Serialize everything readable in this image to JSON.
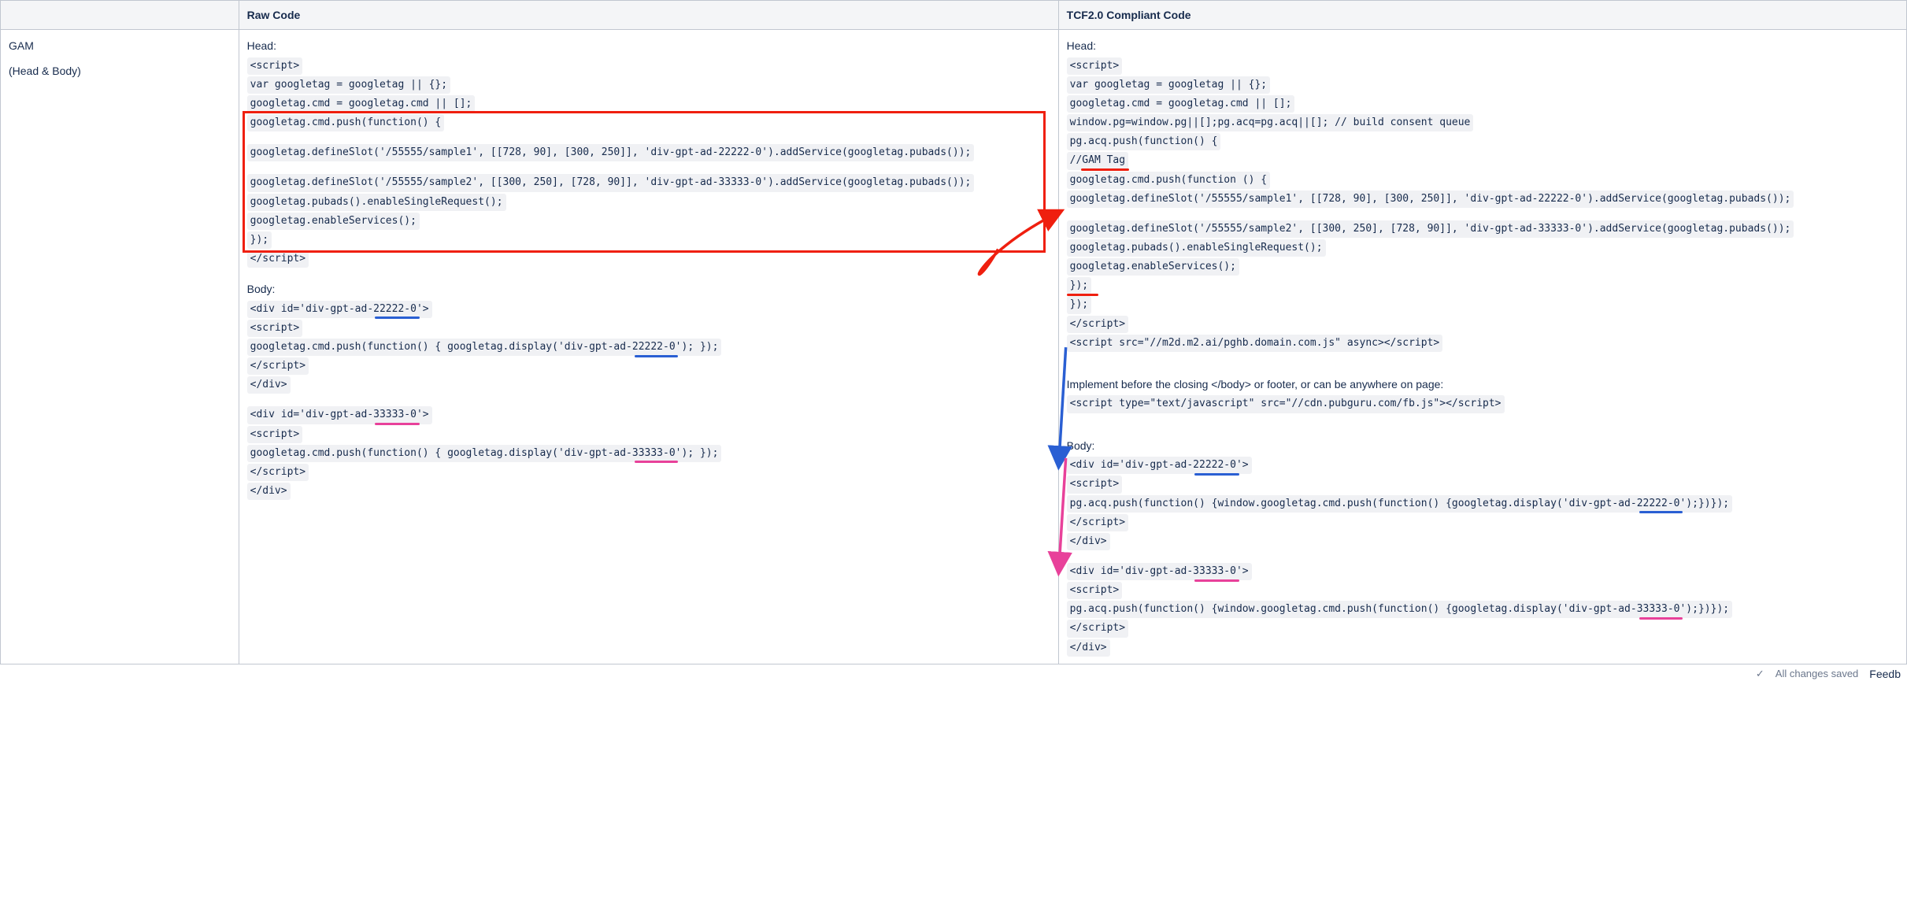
{
  "table": {
    "headers": {
      "col1": "",
      "col2": "Raw Code",
      "col3": "TCF2.0 Compliant Code"
    },
    "row": {
      "name_line1": "GAM",
      "name_line2": "(Head & Body)",
      "raw": {
        "l01": "Head:",
        "l02": "<script>",
        "l03": "var googletag = googletag || {};",
        "l04": "googletag.cmd = googletag.cmd || [];",
        "l05": "googletag.cmd.push(function() {",
        "l06": "googletag.defineSlot('/55555/sample1', [[728, 90], [300, 250]], 'div-gpt-ad-22222-0').addService(googletag.pubads());",
        "l07": "googletag.defineSlot('/55555/sample2', [[300, 250], [728, 90]], 'div-gpt-ad-33333-0').addService(googletag.pubads());",
        "l08": "googletag.pubads().enableSingleRequest();",
        "l09": "googletag.enableServices();",
        "l10": "});",
        "l11": "</script>",
        "l12": "Body:",
        "l13": "<div id='div-gpt-ad-22222-0'>",
        "l14": "<script>",
        "l15": "googletag.cmd.push(function() { googletag.display('div-gpt-ad-22222-0'); });",
        "l16": "</script>",
        "l17": "</div>",
        "l18": "<div id='div-gpt-ad-33333-0'>",
        "l19": "<script>",
        "l20": "googletag.cmd.push(function() { googletag.display('div-gpt-ad-33333-0'); });",
        "l21": "</script>",
        "l22": "</div>"
      },
      "tcf": {
        "l01": "Head:",
        "l02": "<script>",
        "l03": "var googletag = googletag || {};",
        "l04": "googletag.cmd = googletag.cmd || [];",
        "l05": "window.pg=window.pg||[];pg.acq=pg.acq||[]; // build consent queue",
        "l06": "pg.acq.push(function() {",
        "l07": "//GAM Tag",
        "l08": "googletag.cmd.push(function () {",
        "l09": "googletag.defineSlot('/55555/sample1', [[728, 90], [300, 250]], 'div-gpt-ad-22222-0').addService(googletag.pubads());",
        "l10": "googletag.defineSlot('/55555/sample2', [[300, 250], [728, 90]], 'div-gpt-ad-33333-0').addService(googletag.pubads());",
        "l11": "googletag.pubads().enableSingleRequest();",
        "l12": "googletag.enableServices();",
        "l13": "});",
        "l14": "});",
        "l15": "</script>",
        "l16": "<script src=\"//m2d.m2.ai/pghb.domain.com.js\" async></script>",
        "l17": "Implement before the closing </body> or footer, or can be anywhere on page:",
        "l18": "<script type=\"text/javascript\" src=\"//cdn.pubguru.com/fb.js\"></script>",
        "l19": "Body:",
        "l20": "<div id='div-gpt-ad-22222-0'>",
        "l21": "<script>",
        "l22": "pg.acq.push(function() {window.googletag.cmd.push(function() {googletag.display('div-gpt-ad-22222-0');})});",
        "l23": "</script>",
        "l24": "</div>",
        "l25": "<div id='div-gpt-ad-33333-0'>",
        "l26": "<script>",
        "l27": "pg.acq.push(function() {window.googletag.cmd.push(function() {googletag.display('div-gpt-ad-33333-0');})});",
        "l28": "</script>",
        "l29": "</div>"
      }
    }
  },
  "footer": {
    "saved": "All changes saved",
    "feedback": "Feedb"
  },
  "annotations": {
    "colors": {
      "red": "#ef1f0f",
      "blue": "#2a5fd3",
      "pink": "#e8419a"
    }
  }
}
